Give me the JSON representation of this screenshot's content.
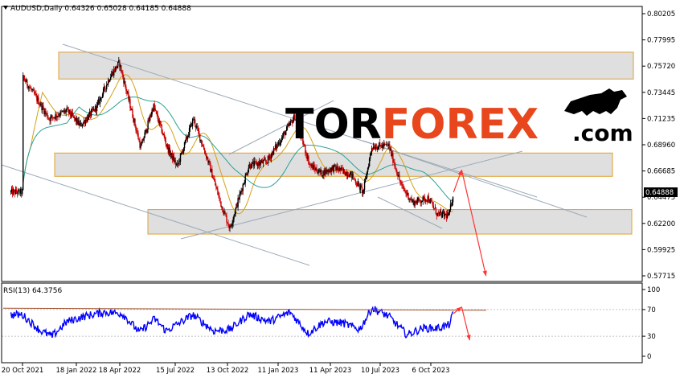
{
  "chart_data": [
    {
      "type": "candlestick",
      "symbol_line": "AUDUSD,Daily  0.64326 0.65028 0.64185 0.64888",
      "last_price": "0.64888",
      "y_ticks": [
        "0.80205",
        "0.77995",
        "0.75720",
        "0.73445",
        "0.71235",
        "0.68960",
        "0.66685",
        "0.64475",
        "0.62200",
        "0.59925",
        "0.57715"
      ],
      "x_ticks": [
        "20 Oct 2021",
        "18 Jan 2022",
        "18 Apr 2022",
        "15 Jul 2022",
        "13 Oct 2022",
        "11 Jan 2023",
        "11 Apr 2023",
        "10 Jul 2023",
        "6 Oct 2023"
      ],
      "ylim": [
        0.572,
        0.807
      ],
      "support_resistance_zones": [
        {
          "low": 0.746,
          "high": 0.769
        },
        {
          "low": 0.6625,
          "high": 0.6825
        },
        {
          "low": 0.613,
          "high": 0.634
        }
      ],
      "close_path": [
        {
          "date": "2021-10-20",
          "close": 0.748
        },
        {
          "date": "2021-11-10",
          "close": 0.732
        },
        {
          "date": "2021-12-05",
          "close": 0.712
        },
        {
          "date": "2022-01-05",
          "close": 0.719
        },
        {
          "date": "2022-01-28",
          "close": 0.706
        },
        {
          "date": "2022-02-25",
          "close": 0.722
        },
        {
          "date": "2022-03-20",
          "close": 0.748
        },
        {
          "date": "2022-04-05",
          "close": 0.76
        },
        {
          "date": "2022-04-25",
          "close": 0.721
        },
        {
          "date": "2022-05-12",
          "close": 0.687
        },
        {
          "date": "2022-06-03",
          "close": 0.723
        },
        {
          "date": "2022-06-28",
          "close": 0.686
        },
        {
          "date": "2022-07-14",
          "close": 0.671
        },
        {
          "date": "2022-08-11",
          "close": 0.712
        },
        {
          "date": "2022-09-05",
          "close": 0.676
        },
        {
          "date": "2022-09-28",
          "close": 0.638
        },
        {
          "date": "2022-10-13",
          "close": 0.618
        },
        {
          "date": "2022-10-28",
          "close": 0.643
        },
        {
          "date": "2022-11-15",
          "close": 0.672
        },
        {
          "date": "2022-12-15",
          "close": 0.675
        },
        {
          "date": "2023-01-10",
          "close": 0.695
        },
        {
          "date": "2023-02-02",
          "close": 0.714
        },
        {
          "date": "2023-02-28",
          "close": 0.672
        },
        {
          "date": "2023-03-20",
          "close": 0.665
        },
        {
          "date": "2023-04-11",
          "close": 0.67
        },
        {
          "date": "2023-05-10",
          "close": 0.664
        },
        {
          "date": "2023-05-31",
          "close": 0.649
        },
        {
          "date": "2023-06-15",
          "close": 0.688
        },
        {
          "date": "2023-07-14",
          "close": 0.689
        },
        {
          "date": "2023-08-05",
          "close": 0.654
        },
        {
          "date": "2023-08-25",
          "close": 0.64
        },
        {
          "date": "2023-09-20",
          "close": 0.644
        },
        {
          "date": "2023-10-06",
          "close": 0.63
        },
        {
          "date": "2023-10-26",
          "close": 0.629
        },
        {
          "date": "2023-11-03",
          "close": 0.6489
        }
      ],
      "forecast_arrows": [
        {
          "from": {
            "date": "2023-11-03",
            "price": 0.6489
          },
          "to": {
            "date": "2023-11-17",
            "price": 0.668
          }
        },
        {
          "from": {
            "date": "2023-11-17",
            "price": 0.668
          },
          "to": {
            "date": "2023-12-29",
            "price": 0.577
          }
        }
      ]
    },
    {
      "type": "line",
      "label": "RSI(13) 64.3756",
      "y_ticks": [
        "100",
        "70",
        "30",
        "0"
      ],
      "levels": [
        70,
        30
      ],
      "ylim": [
        0,
        100
      ],
      "rsi_path": [
        {
          "date": "2021-10-20",
          "value": 62
        },
        {
          "date": "2021-11-20",
          "value": 38
        },
        {
          "date": "2021-12-10",
          "value": 30
        },
        {
          "date": "2022-01-05",
          "value": 52
        },
        {
          "date": "2022-02-05",
          "value": 60
        },
        {
          "date": "2022-03-10",
          "value": 66
        },
        {
          "date": "2022-04-10",
          "value": 64
        },
        {
          "date": "2022-05-10",
          "value": 36
        },
        {
          "date": "2022-06-05",
          "value": 56
        },
        {
          "date": "2022-06-25",
          "value": 38
        },
        {
          "date": "2022-08-10",
          "value": 62
        },
        {
          "date": "2022-09-15",
          "value": 38
        },
        {
          "date": "2022-10-13",
          "value": 40
        },
        {
          "date": "2022-11-15",
          "value": 63
        },
        {
          "date": "2022-12-20",
          "value": 52
        },
        {
          "date": "2023-01-25",
          "value": 66
        },
        {
          "date": "2023-02-25",
          "value": 34
        },
        {
          "date": "2023-03-25",
          "value": 52
        },
        {
          "date": "2023-04-25",
          "value": 50
        },
        {
          "date": "2023-05-25",
          "value": 40
        },
        {
          "date": "2023-06-15",
          "value": 72
        },
        {
          "date": "2023-07-14",
          "value": 60
        },
        {
          "date": "2023-08-15",
          "value": 32
        },
        {
          "date": "2023-09-10",
          "value": 42
        },
        {
          "date": "2023-10-06",
          "value": 42
        },
        {
          "date": "2023-10-26",
          "value": 47
        },
        {
          "date": "2023-11-03",
          "value": 64
        }
      ],
      "trend_line": [
        {
          "date": "2021-10-20",
          "value": 72
        },
        {
          "date": "2023-12-31",
          "value": 69
        }
      ],
      "forecast_arrows": [
        {
          "from": {
            "date": "2023-11-03",
            "value": 64
          },
          "to": {
            "date": "2023-11-17",
            "value": 74
          }
        },
        {
          "from": {
            "date": "2023-11-17",
            "value": 74
          },
          "to": {
            "date": "2023-12-01",
            "value": 24
          }
        }
      ]
    }
  ],
  "watermark": {
    "part1": "TOR",
    "part2": "FOREX",
    "part3": ".com"
  },
  "colors": {
    "bull": "#000000",
    "bear": "#cc0000",
    "rsi_line": "#0000ff",
    "ma_fast": "#d4a017",
    "ma_slow": "#2aa198",
    "zone_fill": "#d9d9d9",
    "zone_border": "#e0a030",
    "forecast": "#ff3333",
    "rsi_level": "#a0522d",
    "channel": "#9aaab8",
    "brand_red": "#e8461c",
    "brand_black": "#000000"
  }
}
